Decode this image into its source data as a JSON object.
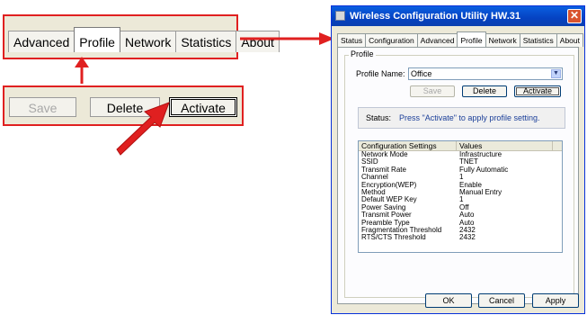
{
  "zoom_tabs": [
    "Advanced",
    "Profile",
    "Network",
    "Statistics",
    "About"
  ],
  "zoom_active_tab": "Profile",
  "zoom_buttons": {
    "save": "Save",
    "delete": "Delete",
    "activate": "Activate"
  },
  "dialog": {
    "title": "Wireless Configuration Utility HW.31",
    "close_glyph": "✕",
    "tabs": [
      "Status",
      "Configuration",
      "Advanced",
      "Profile",
      "Network",
      "Statistics",
      "About"
    ],
    "active_tab": "Profile",
    "group_label": "Profile",
    "profile_name_label": "Profile Name:",
    "profile_name_value": "Office",
    "save_label": "Save",
    "delete_label": "Delete",
    "activate_label": "Activate",
    "status_label": "Status:",
    "status_text": "Press \"Activate\" to apply profile setting.",
    "table": {
      "headers": [
        "Configuration Settings",
        "Values"
      ],
      "rows": [
        [
          "Network Mode",
          "Infrastructure"
        ],
        [
          "SSID",
          "TNET"
        ],
        [
          "Transmit Rate",
          "Fully Automatic"
        ],
        [
          "Channel",
          "1"
        ],
        [
          "Encryption(WEP)",
          "Enable"
        ],
        [
          "Method",
          "Manual Entry"
        ],
        [
          "Default WEP Key",
          "1"
        ],
        [
          "Power Saving",
          "Off"
        ],
        [
          "Transmit Power",
          "Auto"
        ],
        [
          "Preamble Type",
          "Auto"
        ],
        [
          "Fragmentation Threshold",
          "2432"
        ],
        [
          "RTS/CTS Threshold",
          "2432"
        ]
      ]
    },
    "ok_label": "OK",
    "cancel_label": "Cancel",
    "apply_label": "Apply"
  },
  "colors": {
    "callout_red": "#e02020",
    "xp_blue": "#0542c2"
  }
}
